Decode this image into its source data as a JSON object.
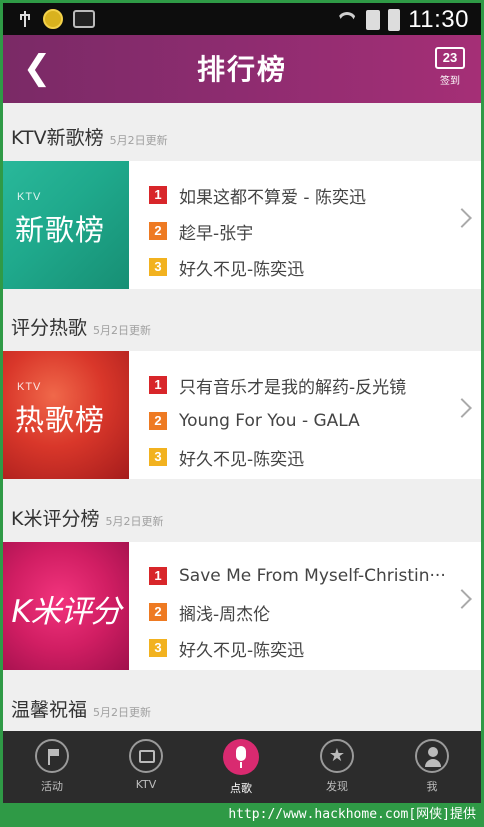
{
  "status_bar": {
    "time": "11:30",
    "left_icons": [
      "usb-icon",
      "coin-app-icon",
      "message-app-icon"
    ],
    "right_icons": [
      "wifi-icon",
      "sim-icon",
      "battery-icon"
    ]
  },
  "header": {
    "title": "排行榜",
    "back_icon": "chevron-left-icon",
    "signin": {
      "day": "23",
      "label": "签到"
    },
    "gradient": [
      "#7a2a66",
      "#a52f76"
    ]
  },
  "sections": [
    {
      "name": "KTV新歌榜",
      "date": "5月2日更新",
      "cover": {
        "small": "KTV",
        "big": "新歌榜",
        "color": "#1fa98c"
      },
      "songs": [
        {
          "rank": "1",
          "text": "如果这都不算爱 - 陈奕迅"
        },
        {
          "rank": "2",
          "text": "趁早-张宇"
        },
        {
          "rank": "3",
          "text": "好久不见-陈奕迅"
        }
      ]
    },
    {
      "name": "评分热歌",
      "date": "5月2日更新",
      "cover": {
        "small": "KTV",
        "big": "热歌榜",
        "color": "#d9372a"
      },
      "songs": [
        {
          "rank": "1",
          "text": "只有音乐才是我的解药-反光镜"
        },
        {
          "rank": "2",
          "text": "Young For You - GALA"
        },
        {
          "rank": "3",
          "text": "好久不见-陈奕迅"
        }
      ]
    },
    {
      "name": "K米评分榜",
      "date": "5月2日更新",
      "cover": {
        "logo": "K米评分",
        "color": "#d11e63"
      },
      "songs": [
        {
          "rank": "1",
          "text": "Save Me From Myself-Christin···"
        },
        {
          "rank": "2",
          "text": "搁浅-周杰伦"
        },
        {
          "rank": "3",
          "text": "好久不见-陈奕迅"
        }
      ]
    },
    {
      "name": "温馨祝福",
      "date": "5月2日更新"
    }
  ],
  "rank_colors": {
    "1": "#d8262a",
    "2": "#ee7a22",
    "3": "#f2b21f"
  },
  "bottom_nav": {
    "items": [
      {
        "label": "活动",
        "icon": "flag-icon"
      },
      {
        "label": "KTV",
        "icon": "tv-icon"
      },
      {
        "label": "点歌",
        "icon": "microphone-icon",
        "active": true
      },
      {
        "label": "发现",
        "icon": "star-icon"
      },
      {
        "label": "我",
        "icon": "person-icon"
      }
    ],
    "active_color": "#d92a70"
  },
  "watermark": "http://www.hackhome.com[网侠]提供"
}
